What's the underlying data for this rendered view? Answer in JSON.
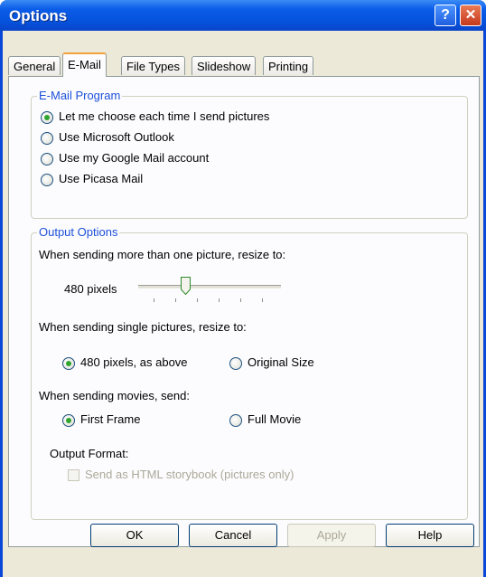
{
  "window": {
    "title": "Options",
    "help_glyph": "?",
    "close_glyph": "✕"
  },
  "tabs": [
    "General",
    "E-Mail",
    "File Types",
    "Slideshow",
    "Printing"
  ],
  "email_program": {
    "legend": "E-Mail Program",
    "options": [
      {
        "label": "Let me choose each time I send pictures",
        "checked": true
      },
      {
        "label": "Use Microsoft Outlook",
        "checked": false
      },
      {
        "label": "Use my Google Mail account",
        "checked": false
      },
      {
        "label": "Use Picasa Mail",
        "checked": false
      }
    ]
  },
  "output_options": {
    "legend": "Output Options",
    "resize_multi_label": "When sending more than one picture, resize to:",
    "slider_value_label": "480 pixels",
    "slider_position": 0.33,
    "resize_single_label": "When sending single pictures, resize to:",
    "single_options": [
      {
        "label": "480 pixels, as above",
        "checked": true
      },
      {
        "label": "Original Size",
        "checked": false
      }
    ],
    "movies_label": "When sending movies, send:",
    "movie_options": [
      {
        "label": "First Frame",
        "checked": true
      },
      {
        "label": "Full Movie",
        "checked": false
      }
    ],
    "format_label": "Output Format:",
    "storybook_label": "Send as HTML storybook (pictures only)"
  },
  "buttons": {
    "ok": "OK",
    "cancel": "Cancel",
    "apply": "Apply",
    "help": "Help"
  }
}
